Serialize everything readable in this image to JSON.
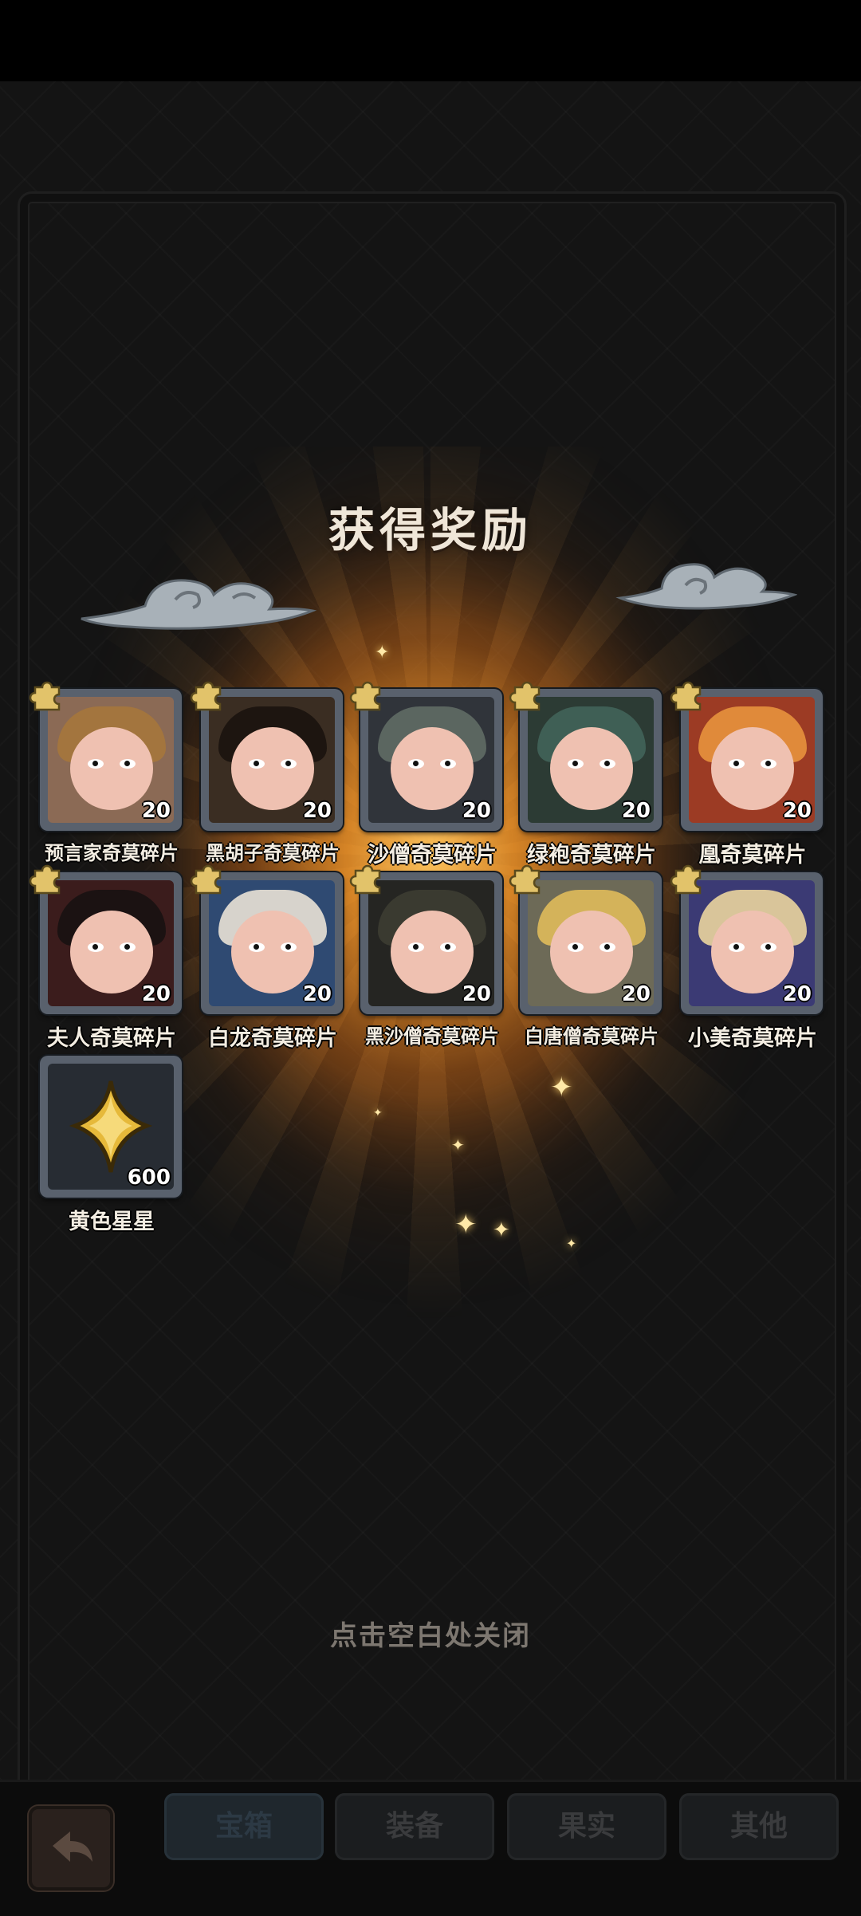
{
  "title": "获得奖励",
  "rewards": [
    {
      "label": "预言家奇莫碎片",
      "qty": "20",
      "icon": "puzzle-piece-icon",
      "bg": "#8b6a55",
      "hair": "#a3753e"
    },
    {
      "label": "黑胡子奇莫碎片",
      "qty": "20",
      "icon": "puzzle-piece-icon",
      "bg": "#3a2d22",
      "hair": "#1d1510"
    },
    {
      "label": "沙僧奇莫碎片",
      "qty": "20",
      "icon": "puzzle-piece-icon",
      "bg": "#30343a",
      "hair": "#5b6660"
    },
    {
      "label": "绿袍奇莫碎片",
      "qty": "20",
      "icon": "puzzle-piece-icon",
      "bg": "#2c3b34",
      "hair": "#3f5f55"
    },
    {
      "label": "凰奇莫碎片",
      "qty": "20",
      "icon": "puzzle-piece-icon",
      "bg": "#9c3b24",
      "hair": "#e08a3a"
    },
    {
      "label": "夫人奇莫碎片",
      "qty": "20",
      "icon": "puzzle-piece-icon",
      "bg": "#3b1c1c",
      "hair": "#1b1212"
    },
    {
      "label": "白龙奇莫碎片",
      "qty": "20",
      "icon": "puzzle-piece-icon",
      "bg": "#2f4a72",
      "hair": "#d7d3cc"
    },
    {
      "label": "黑沙僧奇莫碎片",
      "qty": "20",
      "icon": "puzzle-piece-icon",
      "bg": "#252522",
      "hair": "#3a3a30"
    },
    {
      "label": "白唐僧奇莫碎片",
      "qty": "20",
      "icon": "puzzle-piece-icon",
      "bg": "#6d6a57",
      "hair": "#d4b35a"
    },
    {
      "label": "小美奇莫碎片",
      "qty": "20",
      "icon": "puzzle-piece-icon",
      "bg": "#3b3a74",
      "hair": "#d9c59a"
    },
    {
      "label": "黄色星星",
      "qty": "600",
      "icon": "yellow-star-icon",
      "bg": "#272c33",
      "hair": ""
    }
  ],
  "close_hint": "点击空白处关闭",
  "bottom_tabs": [
    {
      "label": "宝箱",
      "active": true
    },
    {
      "label": "装备",
      "active": false
    },
    {
      "label": "果实",
      "active": false
    },
    {
      "label": "其他",
      "active": false
    }
  ],
  "colors": {
    "accent_gold": "#f2b640",
    "puzzle_gold": "#e2c36a",
    "frame_gray": "#59616d"
  }
}
